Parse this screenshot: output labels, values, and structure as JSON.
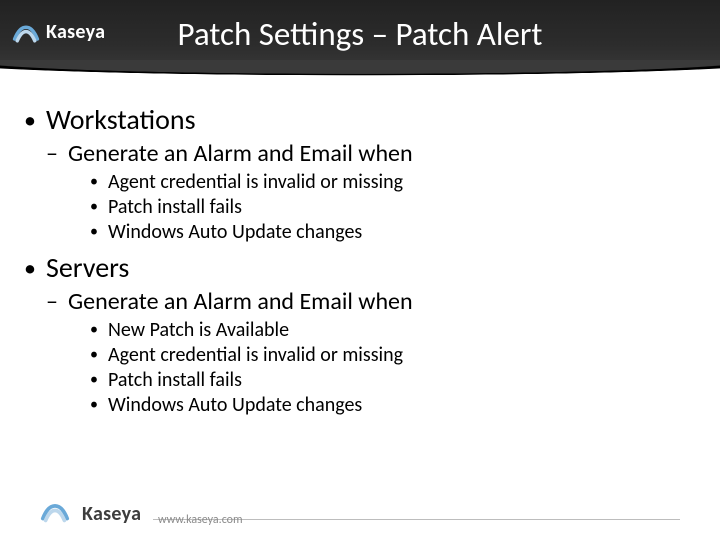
{
  "brand": "Kaseya",
  "title": "Patch Settings – Patch Alert",
  "footer_url": "www.kaseya.com",
  "sections": [
    {
      "heading": "Workstations",
      "sub": "Generate an Alarm and Email when",
      "items": [
        "Agent credential is invalid or missing",
        "Patch install fails",
        "Windows Auto Update changes"
      ]
    },
    {
      "heading": "Servers",
      "sub": "Generate an Alarm and Email when",
      "items": [
        "New Patch is Available",
        "Agent credential is invalid or missing",
        "Patch install fails",
        "Windows Auto Update changes"
      ]
    }
  ]
}
